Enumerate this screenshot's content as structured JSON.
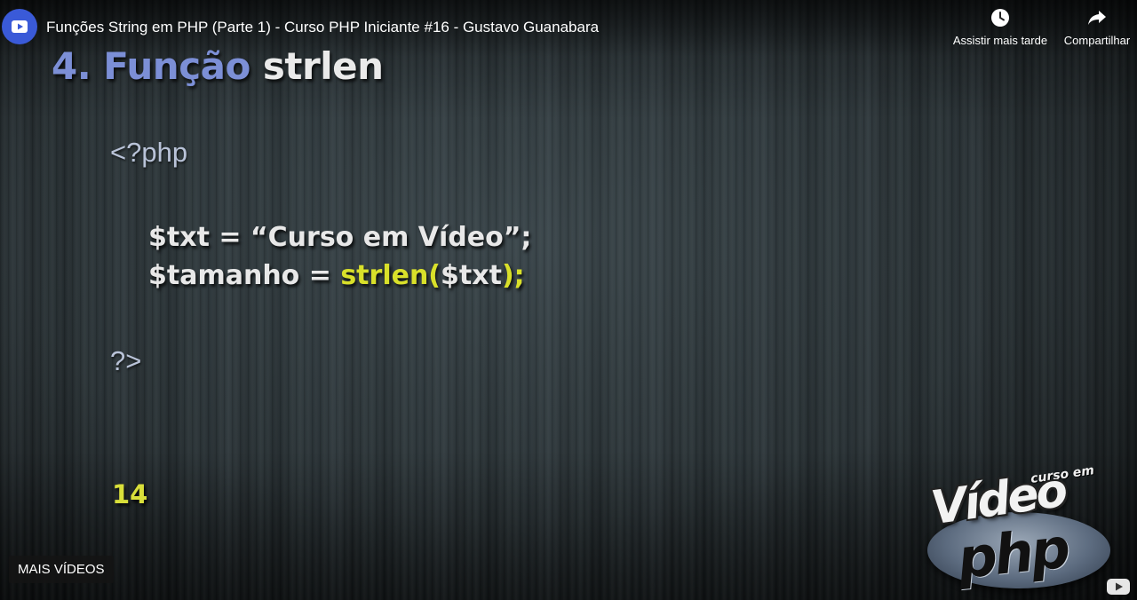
{
  "header": {
    "title": "Funções String em PHP (Parte 1) - Curso PHP Iniciante #16 - Gustavo Guanabara",
    "channel_icon": "channel-logo-icon",
    "actions": {
      "watch_later": {
        "label": "Assistir mais tarde",
        "icon": "clock-icon"
      },
      "share": {
        "label": "Compartilhar",
        "icon": "share-arrow-icon"
      }
    }
  },
  "slide": {
    "title_number": "4. Função",
    "title_function": "strlen",
    "php_open": "<?php",
    "line1": "$txt = “Curso em Vídeo”;",
    "line2_prefix": "$tamanho = ",
    "line2_highlight": "strlen(",
    "line2_arg": "$txt",
    "line2_close": ");",
    "php_close": "?>",
    "output": "14"
  },
  "brand": {
    "small": "curso em",
    "word1": "Vídeo",
    "word2": "php"
  },
  "footer": {
    "more_videos": "MAIS VÍDEOS",
    "youtube_icon": "youtube-logo-icon"
  },
  "colors": {
    "title_number": "#7c8fd6",
    "highlight": "#d9e02a",
    "output": "#d9df3a",
    "channel_logo_bg": "#3a5ad8"
  }
}
